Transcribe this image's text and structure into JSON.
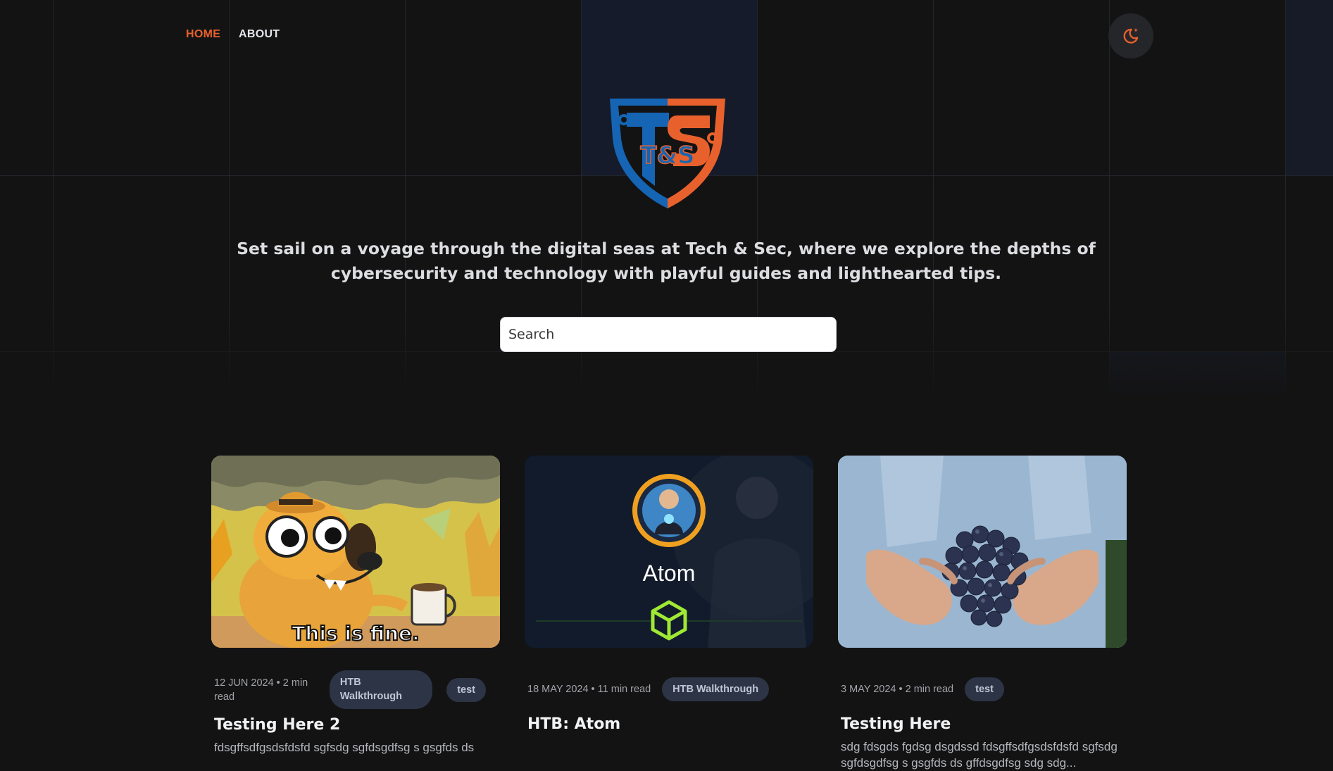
{
  "nav": {
    "home_label": "HOME",
    "about_label": "ABOUT"
  },
  "theme_toggle": {
    "icon": "moon-sparkle-icon"
  },
  "logo": {
    "text": "T&S"
  },
  "hero": {
    "tagline": "Set sail on a voyage through the digital seas at Tech & Sec, where we explore the depths of cybersecurity and technology with playful guides and lighthearted tips."
  },
  "search": {
    "placeholder": "Search",
    "value": ""
  },
  "posts": [
    {
      "image_caption": "This is fine.",
      "meta": "12 JUN 2024 • 2 min read",
      "tags": [
        "HTB Walkthrough",
        "test"
      ],
      "title": "Testing Here 2",
      "excerpt": "fdsgffsdfgsdsfdsfd sgfsdg sgfdsgdfsg s gsgfds ds"
    },
    {
      "image_caption": "Atom",
      "meta": "18 MAY 2024 • 11 min read",
      "tags": [
        "HTB Walkthrough"
      ],
      "title": "HTB: Atom",
      "excerpt": ""
    },
    {
      "image_caption": "",
      "meta": "3 MAY 2024 • 2 min read",
      "tags": [
        "test"
      ],
      "title": "Testing Here",
      "excerpt": "sdg fdsgds fgdsg dsgdssd fdsgffsdfgsdsfdsfd sgfsdg sgfdsgdfsg s gsgfds ds gffdsgdfsg sdg sdg..."
    }
  ],
  "colors": {
    "accent": "#e8612c",
    "background": "#131314",
    "tag_bg": "#2d3445",
    "logo_blue": "#1565b4",
    "logo_orange": "#e8612c"
  }
}
